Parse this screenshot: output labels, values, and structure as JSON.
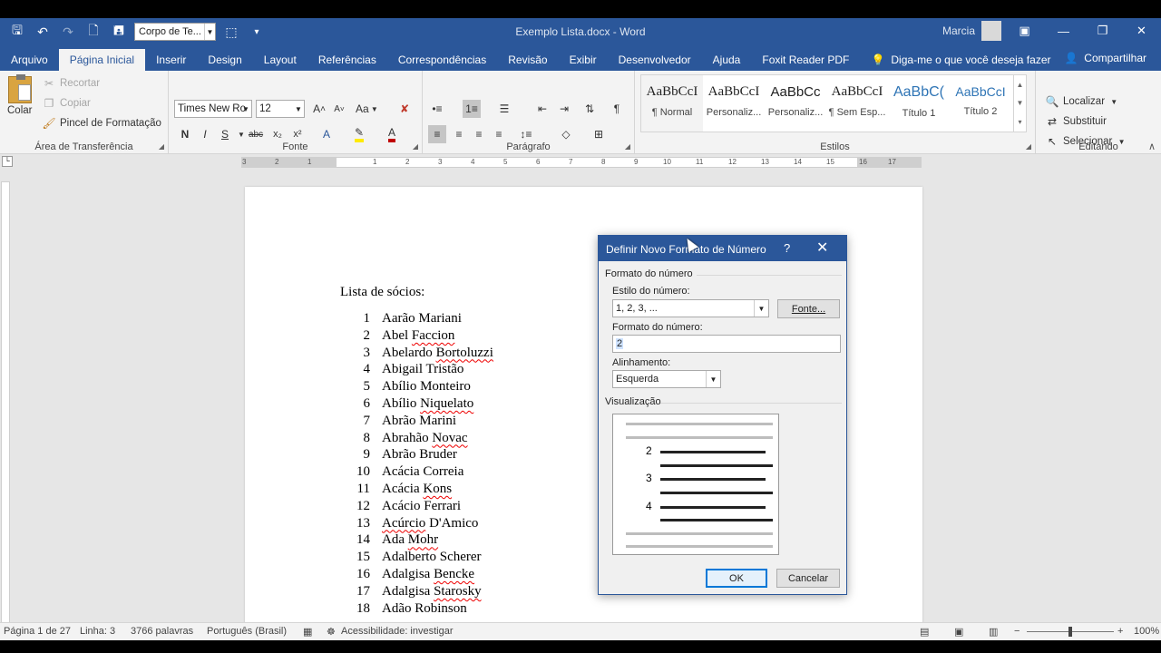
{
  "app": {
    "doc_title": "Exemplo Lista.docx  -  Word",
    "user": "Marcia",
    "style_combo": "Corpo de Te...",
    "window_controls": [
      "ribbon-display-icon",
      "minimize-icon",
      "restore-icon",
      "close-icon"
    ]
  },
  "tabs": [
    {
      "label": "Arquivo",
      "active": false
    },
    {
      "label": "Página Inicial",
      "active": true
    },
    {
      "label": "Inserir",
      "active": false
    },
    {
      "label": "Design",
      "active": false
    },
    {
      "label": "Layout",
      "active": false
    },
    {
      "label": "Referências",
      "active": false
    },
    {
      "label": "Correspondências",
      "active": false
    },
    {
      "label": "Revisão",
      "active": false
    },
    {
      "label": "Exibir",
      "active": false
    },
    {
      "label": "Desenvolvedor",
      "active": false
    },
    {
      "label": "Ajuda",
      "active": false
    },
    {
      "label": "Foxit Reader PDF",
      "active": false
    }
  ],
  "tellme": "Diga-me o que você deseja fazer",
  "share": "Compartilhar",
  "ribbon": {
    "clipboard": {
      "label": "Área de Transferência",
      "paste": "Colar",
      "cut": "Recortar",
      "copy": "Copiar",
      "format_painter": "Pincel de Formatação"
    },
    "font": {
      "label": "Fonte",
      "font_name": "Times New Ro",
      "font_size": "12",
      "bold": "N",
      "italic": "I",
      "underline": "S",
      "strike": "abc",
      "subscript": "x₂",
      "superscript": "x²",
      "case": "Aa",
      "grow": "A",
      "shrink": "A"
    },
    "paragraph": {
      "label": "Parágrafo"
    },
    "styles": {
      "label": "Estilos",
      "items": [
        {
          "sample": "AaBbCcI",
          "name": "¶ Normal",
          "heading": false
        },
        {
          "sample": "AaBbCcI",
          "name": "Personaliz...",
          "heading": false
        },
        {
          "sample": "AaBbCc",
          "name": "Personaliz...",
          "heading": false
        },
        {
          "sample": "AaBbCcI",
          "name": "¶ Sem Esp...",
          "heading": false
        },
        {
          "sample": "AaBbC(",
          "name": "Título 1",
          "heading": true
        },
        {
          "sample": "AaBbCcI",
          "name": "Título 2",
          "heading": true
        }
      ]
    },
    "editing": {
      "label": "Editando",
      "find": "Localizar",
      "replace": "Substituir",
      "select": "Selecionar"
    }
  },
  "ruler": {
    "ticks": [
      "3",
      "2",
      "1",
      "1",
      "2",
      "3",
      "4",
      "5",
      "6",
      "7",
      "8",
      "9",
      "10",
      "11",
      "12",
      "13",
      "14",
      "15",
      "16",
      "17"
    ]
  },
  "document": {
    "list_title": "Lista de sócios:",
    "items": [
      {
        "n": "1",
        "text": "Aarão Mariani",
        "squiggle": ""
      },
      {
        "n": "2",
        "text": "Abel ",
        "squiggle": "Faccion"
      },
      {
        "n": "3",
        "text": "Abelardo ",
        "squiggle": "Bortoluzzi"
      },
      {
        "n": "4",
        "text": "Abigail Tristão",
        "squiggle": ""
      },
      {
        "n": "5",
        "text": "Abílio Monteiro",
        "squiggle": ""
      },
      {
        "n": "6",
        "text": "Abílio ",
        "squiggle": "Niquelato"
      },
      {
        "n": "7",
        "text": "Abrão Marini",
        "squiggle": ""
      },
      {
        "n": "8",
        "text": "Abrahão ",
        "squiggle": "Novac"
      },
      {
        "n": "9",
        "text": "Abrão Bruder",
        "squiggle": ""
      },
      {
        "n": "10",
        "text": "Acácia Correia",
        "squiggle": ""
      },
      {
        "n": "11",
        "text": "Acácia ",
        "squiggle": "Kons"
      },
      {
        "n": "12",
        "text": "Acácio Ferrari",
        "squiggle": ""
      },
      {
        "n": "13",
        "text": "",
        "squiggle": "Acúrcio",
        "after": " D'Amico"
      },
      {
        "n": "14",
        "text": "Ada ",
        "squiggle": "Mohr"
      },
      {
        "n": "15",
        "text": "Adalberto Scherer",
        "squiggle": ""
      },
      {
        "n": "16",
        "text": "Adalgisa ",
        "squiggle": "Bencke"
      },
      {
        "n": "17",
        "text": "Adalgisa ",
        "squiggle": "Starosky"
      },
      {
        "n": "18",
        "text": "Adão Robinson",
        "squiggle": ""
      }
    ]
  },
  "status": {
    "page": "Página 1 de 27",
    "line": "Linha: 3",
    "words": "3766 palavras",
    "language": "Português (Brasil)",
    "accessibility": "Acessibilidade: investigar",
    "zoom": "100%"
  },
  "dialog": {
    "title": "Definir Novo Formato de Número",
    "help": "?",
    "group_format": "Formato do número",
    "style_label": "Estilo do número:",
    "style_value": "1, 2, 3, ...",
    "font_button": "Fonte...",
    "format_label": "Formato do número:",
    "format_value": "2",
    "align_label": "Alinhamento:",
    "align_value": "Esquerda",
    "preview_label": "Visualização",
    "preview_numbers": [
      "2",
      "3",
      "4"
    ],
    "ok": "OK",
    "cancel": "Cancelar"
  }
}
